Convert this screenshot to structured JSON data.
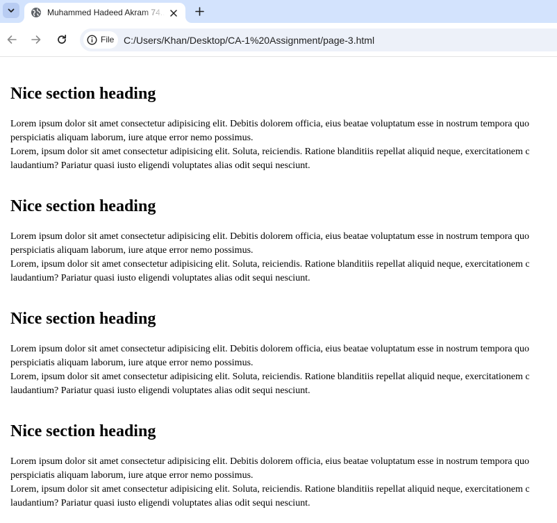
{
  "browser": {
    "tab": {
      "title": "Muhammed Hadeed Akram 74..."
    },
    "address_bar": {
      "chip_label": "File",
      "url": "C:/Users/Khan/Desktop/CA-1%20Assignment/page-3.html"
    },
    "icons": {
      "tab_search": "chevron-down-icon",
      "favicon": "globe-icon",
      "close": "close-icon",
      "new_tab": "plus-icon",
      "back": "back-arrow-icon",
      "forward": "forward-arrow-icon",
      "reload": "reload-icon",
      "info": "info-icon"
    },
    "colors": {
      "tabstrip": "#d3e3fd",
      "omnibox": "#edf1f9"
    }
  },
  "page": {
    "sections": [
      {
        "heading": "Nice section heading",
        "line1": "Lorem ipsum dolor sit amet consectetur adipisicing elit. Debitis dolorem officia, eius beatae voluptatum esse in nostrum tempora quo",
        "line2": "perspiciatis aliquam laborum, iure atque error nemo possimus.",
        "line3": "Lorem, ipsum dolor sit amet consectetur adipisicing elit. Soluta, reiciendis. Ratione blanditiis repellat aliquid neque, exercitationem c",
        "line4": "laudantium? Pariatur quasi iusto eligendi voluptates alias odit sequi nesciunt."
      },
      {
        "heading": "Nice section heading",
        "line1": "Lorem ipsum dolor sit amet consectetur adipisicing elit. Debitis dolorem officia, eius beatae voluptatum esse in nostrum tempora quo",
        "line2": "perspiciatis aliquam laborum, iure atque error nemo possimus.",
        "line3": "Lorem, ipsum dolor sit amet consectetur adipisicing elit. Soluta, reiciendis. Ratione blanditiis repellat aliquid neque, exercitationem c",
        "line4": "laudantium? Pariatur quasi iusto eligendi voluptates alias odit sequi nesciunt."
      },
      {
        "heading": "Nice section heading",
        "line1": "Lorem ipsum dolor sit amet consectetur adipisicing elit. Debitis dolorem officia, eius beatae voluptatum esse in nostrum tempora quo",
        "line2": "perspiciatis aliquam laborum, iure atque error nemo possimus.",
        "line3": "Lorem, ipsum dolor sit amet consectetur adipisicing elit. Soluta, reiciendis. Ratione blanditiis repellat aliquid neque, exercitationem c",
        "line4": "laudantium? Pariatur quasi iusto eligendi voluptates alias odit sequi nesciunt."
      },
      {
        "heading": "Nice section heading",
        "line1": "Lorem ipsum dolor sit amet consectetur adipisicing elit. Debitis dolorem officia, eius beatae voluptatum esse in nostrum tempora quo",
        "line2": "perspiciatis aliquam laborum, iure atque error nemo possimus.",
        "line3": "Lorem, ipsum dolor sit amet consectetur adipisicing elit. Soluta, reiciendis. Ratione blanditiis repellat aliquid neque, exercitationem c",
        "line4": "laudantium? Pariatur quasi iusto eligendi voluptates alias odit sequi nesciunt."
      }
    ]
  }
}
